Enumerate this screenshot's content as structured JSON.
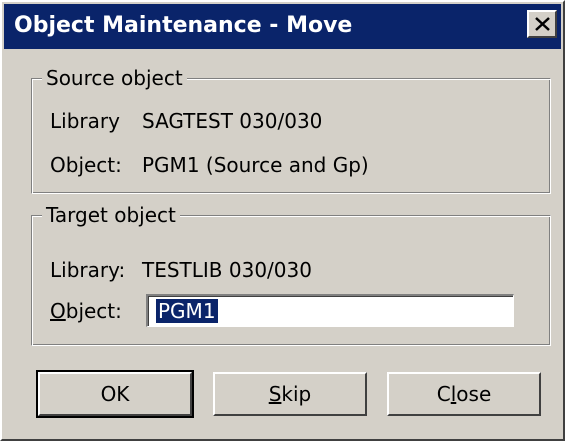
{
  "window": {
    "title": "Object Maintenance - Move"
  },
  "source": {
    "legend": "Source object",
    "library_label": "Library",
    "library_value": "SAGTEST  030/030",
    "object_label": "Object:",
    "object_value": "PGM1 (Source and Gp)"
  },
  "target": {
    "legend": "Target object",
    "library_label": "Library:",
    "library_value": "TESTLIB  030/030",
    "object_label_mnemonic": "O",
    "object_label_rest": "bject:",
    "object_input_value": "PGM1"
  },
  "buttons": {
    "ok": "OK",
    "skip_mnemonic": "S",
    "skip_rest": "kip",
    "close_prefix": "C",
    "close_mnemonic": "l",
    "close_rest": "ose"
  },
  "colors": {
    "titlebar": "#0a246a",
    "dialog_face": "#d4d0c8",
    "selection": "#0a246a"
  },
  "icons": {
    "close": "close-icon"
  }
}
